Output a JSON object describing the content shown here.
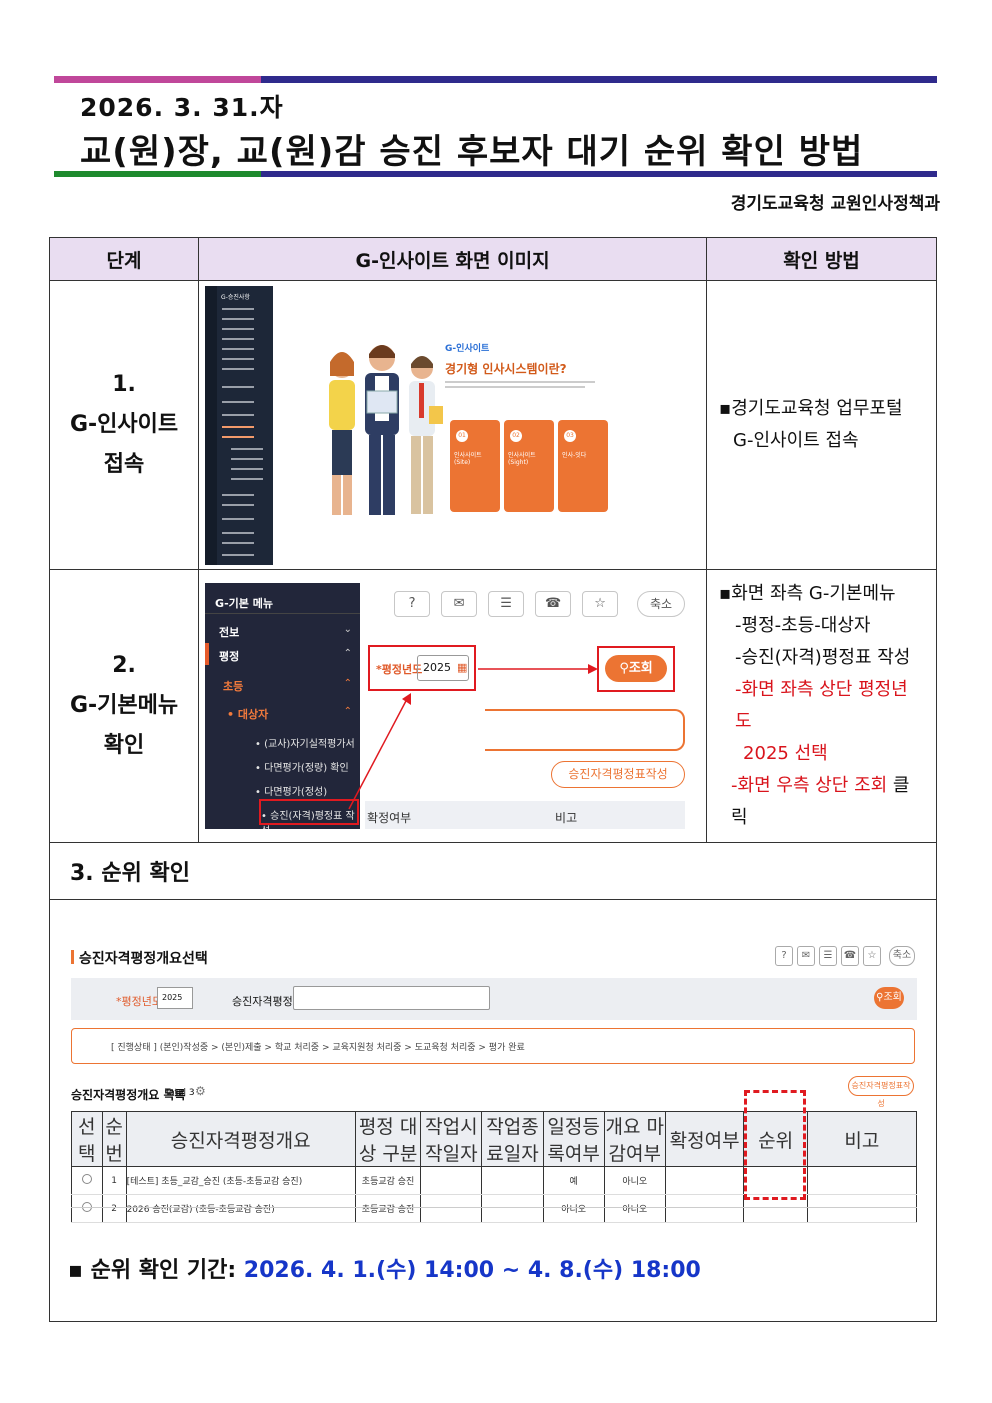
{
  "header": {
    "date": "2026. 3. 31.자",
    "title": "교(원)장, 교(원)감 승진 후보자 대기 순위 확인 방법",
    "dept": "경기도교육청 교원인사정책과"
  },
  "table": {
    "col_step": "단계",
    "col_image": "G-인사이트 화면 이미지",
    "col_method": "확인 방법"
  },
  "step1": {
    "label_num": "1.",
    "label_a": "G-인사이트",
    "label_b": "접속",
    "method_a": "경기도교육청 업무포털",
    "method_b": "G-인사이트 접속",
    "shot": {
      "menu_title": "G-승진사항",
      "brand": "G-인사이트",
      "headline": "경기형 인사시스템이란?",
      "card1_num": "01",
      "card1": "인사사이트(Site)",
      "card2_num": "02",
      "card2": "인사사이트(Sight)",
      "card3_num": "03",
      "card3": "인사-잇다"
    }
  },
  "step2": {
    "label_num": "2.",
    "label_a": "G-기본메뉴",
    "label_b": "확인",
    "method_lead": "화면 좌측 G-기본메뉴",
    "method_1": "-평정-초등-대상자",
    "method_2": "-승진(자격)평정표 작성",
    "method_3": "-화면 좌측 상단 평정년도",
    "method_3b": "2025 선택",
    "method_4_red": "-화면 우측 상단 조회",
    "method_4_black": " 클릭",
    "shot": {
      "menu_title": "G-기본 메뉴",
      "m1": "전보",
      "m2": "평정",
      "m3": "초등",
      "m4": "대상자",
      "s1": "(교사)자기실적평가서",
      "s2": "다면평가(정량) 확인",
      "s3": "다면평가(정성)",
      "s4": "승진(자격)평정표 작성",
      "year_label": "*평정년도",
      "year_value": "2025",
      "search": "조회",
      "shrink": "축소",
      "write_btn": "승진자격평정표작성",
      "col_a": "확정여부",
      "col_b": "비고"
    }
  },
  "step3": {
    "heading": "3. 순위 확인",
    "shot": {
      "page_title": "승진자격평정개요선택",
      "year_label": "*평정년도",
      "year_value": "2025",
      "summary_label": "승진자격평정개요",
      "search": "조회",
      "shrink": "축소",
      "progress": "[ 진행상태 ] (본인)작성중 > (본인)제출 > 학교 처리중 > 교육지원청 처리중 > 도교육청 처리중 > 평가 완료",
      "list_title": "승진자격평정개요 목록",
      "total": "Total 3",
      "write_btn": "승진자격평정표작성",
      "columns": [
        "선택",
        "순번",
        "승진자격평정개요",
        "평정 대상 구분",
        "작업시작일자",
        "작업종료일자",
        "일정등록여부",
        "개요 마감여부",
        "확정여부",
        "순위",
        "비고"
      ],
      "rows": [
        [
          "1",
          "[테스트] 초등_교감_승진 (초등-초등교감 승진)",
          "초등교감 승진",
          "",
          "",
          "예",
          "아니오",
          "",
          "",
          ""
        ],
        [
          "2",
          "2026 승진(교감) (초등-초등교감 승진)",
          "초등교감 승진",
          "",
          "",
          "아니오",
          "아니오",
          "",
          "",
          ""
        ]
      ]
    },
    "period_label": "순위 확인 기간: ",
    "period_value": "2026. 4. 1.(수) 14:00 ~ 4. 8.(수) 18:00"
  },
  "colors": {
    "accent_red": "#d9141c",
    "accent_blue": "#1636c8",
    "header_bg": "#e9ddf1",
    "orange": "#ec7433"
  }
}
